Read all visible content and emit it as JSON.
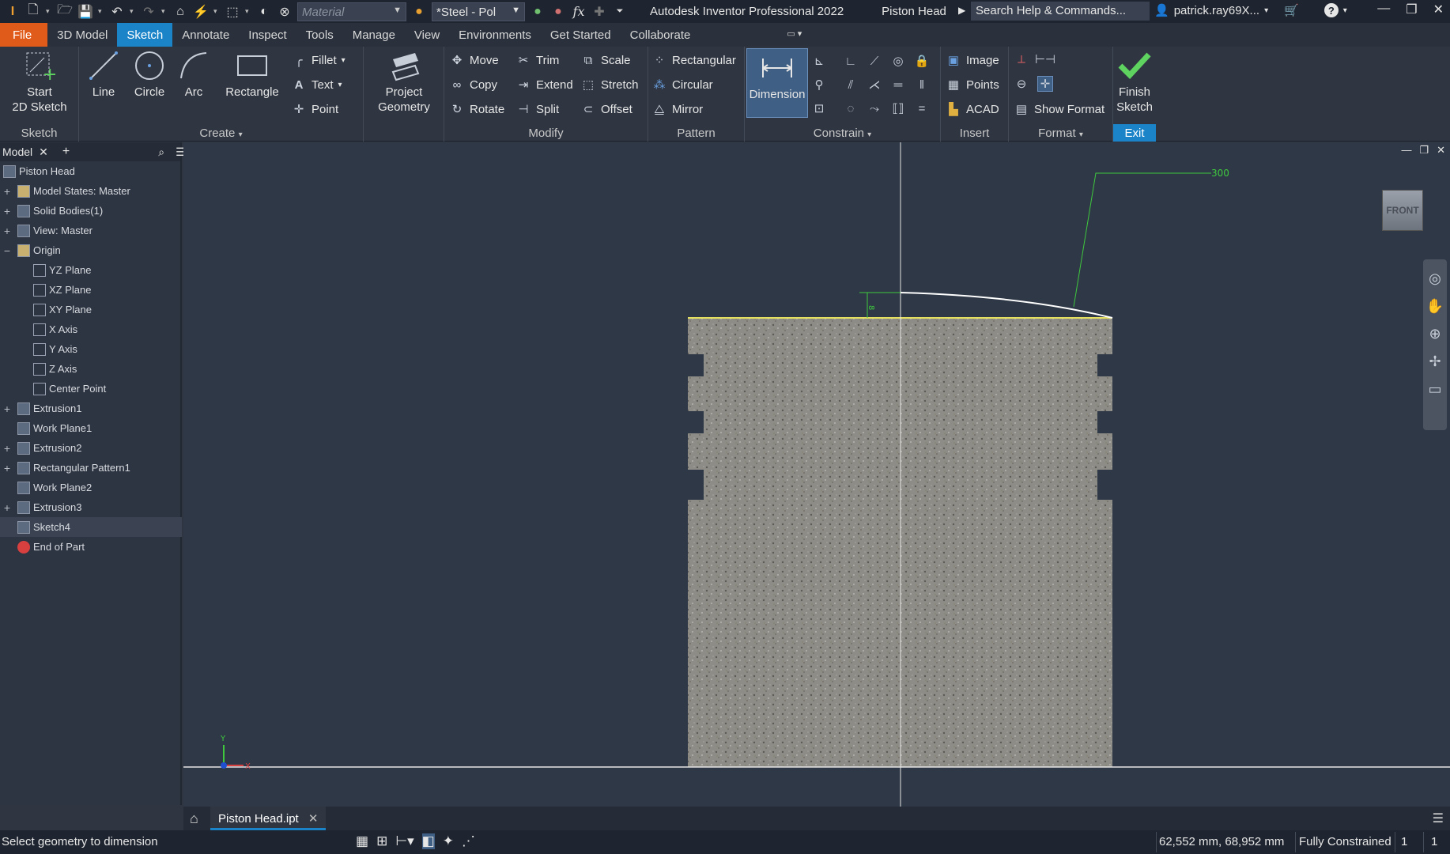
{
  "titlebar": {
    "material_placeholder": "Material",
    "appearance": "*Steel - Pol",
    "fx_icon": "fx",
    "app_title": "Autodesk Inventor Professional 2022",
    "document": "Piston Head",
    "search_placeholder": "Search Help & Commands...",
    "user": "patrick.ray69X..."
  },
  "tabs": [
    "File",
    "3D Model",
    "Sketch",
    "Annotate",
    "Inspect",
    "Tools",
    "Manage",
    "View",
    "Environments",
    "Get Started",
    "Collaborate"
  ],
  "ribbon": {
    "sketch_panel": {
      "label": "Sketch",
      "start_sketch": "Start",
      "start_sketch2": "2D Sketch"
    },
    "create_panel": {
      "label": "Create",
      "line": "Line",
      "circle": "Circle",
      "arc": "Arc",
      "rectangle": "Rectangle",
      "fillet": "Fillet",
      "text": "Text",
      "point": "Point"
    },
    "project_geometry": {
      "line1": "Project",
      "line2": "Geometry"
    },
    "modify_panel": {
      "label": "Modify",
      "move": "Move",
      "copy": "Copy",
      "rotate": "Rotate",
      "trim": "Trim",
      "extend": "Extend",
      "split": "Split",
      "scale": "Scale",
      "stretch": "Stretch",
      "offset": "Offset"
    },
    "pattern_panel": {
      "label": "Pattern",
      "rectangular": "Rectangular",
      "circular": "Circular",
      "mirror": "Mirror"
    },
    "constrain_panel": {
      "label": "Constrain",
      "dimension": "Dimension"
    },
    "insert_panel": {
      "label": "Insert",
      "image": "Image",
      "points": "Points",
      "acad": "ACAD"
    },
    "format_panel": {
      "label": "Format",
      "show_format": "Show Format"
    },
    "exit_panel": {
      "label": "Exit",
      "finish1": "Finish",
      "finish2": "Sketch"
    }
  },
  "browser": {
    "tab": "Model",
    "items": [
      {
        "label": "Piston Head",
        "level": 0,
        "exp": ""
      },
      {
        "label": "Model States: Master",
        "level": 1,
        "exp": "+"
      },
      {
        "label": "Solid Bodies(1)",
        "level": 1,
        "exp": "+"
      },
      {
        "label": "View: Master",
        "level": 1,
        "exp": "+"
      },
      {
        "label": "Origin",
        "level": 1,
        "exp": "−"
      },
      {
        "label": "YZ Plane",
        "level": 2,
        "exp": ""
      },
      {
        "label": "XZ Plane",
        "level": 2,
        "exp": ""
      },
      {
        "label": "XY Plane",
        "level": 2,
        "exp": ""
      },
      {
        "label": "X Axis",
        "level": 2,
        "exp": ""
      },
      {
        "label": "Y Axis",
        "level": 2,
        "exp": ""
      },
      {
        "label": "Z Axis",
        "level": 2,
        "exp": ""
      },
      {
        "label": "Center Point",
        "level": 2,
        "exp": ""
      },
      {
        "label": "Extrusion1",
        "level": 1,
        "exp": "+"
      },
      {
        "label": "Work Plane1",
        "level": 1,
        "exp": ""
      },
      {
        "label": "Extrusion2",
        "level": 1,
        "exp": "+"
      },
      {
        "label": "Rectangular Pattern1",
        "level": 1,
        "exp": "+"
      },
      {
        "label": "Work Plane2",
        "level": 1,
        "exp": ""
      },
      {
        "label": "Extrusion3",
        "level": 1,
        "exp": "+"
      },
      {
        "label": "Sketch4",
        "level": 1,
        "exp": "",
        "selected": true
      },
      {
        "label": "End of Part",
        "level": 1,
        "exp": ""
      }
    ]
  },
  "canvas": {
    "dimension_value": "300",
    "small_dim": "8",
    "viewcube_label": "FRONT",
    "axis_y": "Y",
    "axis_x": "X"
  },
  "doc_tab": "Piston Head.ipt",
  "status": {
    "prompt": "Select geometry to dimension",
    "coords": "62,552 mm, 68,952 mm",
    "constraint": "Fully Constrained",
    "count1": "1",
    "count2": "1"
  }
}
